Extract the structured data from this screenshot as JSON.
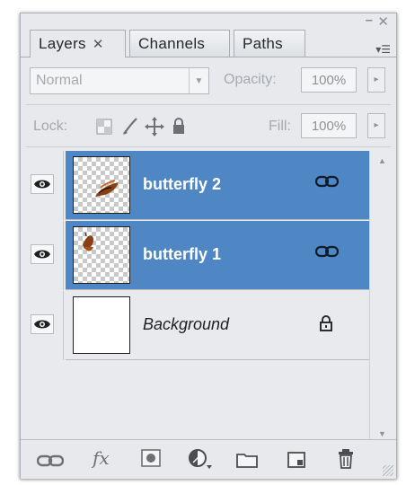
{
  "window": {
    "minimize_glyph": "–",
    "close_glyph": "✕"
  },
  "tabs": [
    {
      "label": "Layers",
      "close": "✕"
    },
    {
      "label": "Channels"
    },
    {
      "label": "Paths"
    }
  ],
  "panel_menu_glyph": "▾☰",
  "blend": {
    "value": "Normal",
    "arrow": "▼"
  },
  "opacity": {
    "label": "Opacity:",
    "value": "100%",
    "arrow": "▸"
  },
  "lock": {
    "label": "Lock:",
    "icons": [
      "lock-transparent-pixels-icon",
      "lock-image-pixels-icon",
      "lock-position-icon",
      "lock-all-icon"
    ]
  },
  "fill": {
    "label": "Fill:",
    "value": "100%",
    "arrow": "▸"
  },
  "layers": [
    {
      "name": "butterfly 2",
      "selected": true,
      "visible": true,
      "badge": "link-icon",
      "thumb": "transparent-with-butterfly"
    },
    {
      "name": "butterfly 1",
      "selected": true,
      "visible": true,
      "badge": "link-icon",
      "thumb": "transparent-with-butterfly"
    },
    {
      "name": "Background",
      "selected": false,
      "visible": true,
      "badge": "lock-icon",
      "thumb": "white"
    }
  ],
  "scroll": {
    "up": "▲",
    "down": "▼"
  },
  "footer": {
    "fx_label": "fx",
    "icons": [
      "link-layers-icon",
      "layer-style-icon",
      "layer-mask-icon",
      "adjustment-layer-icon",
      "new-group-icon",
      "new-layer-icon",
      "delete-layer-icon"
    ]
  },
  "colors": {
    "selection": "#4f87c5",
    "panel": "#e7e9ec"
  }
}
